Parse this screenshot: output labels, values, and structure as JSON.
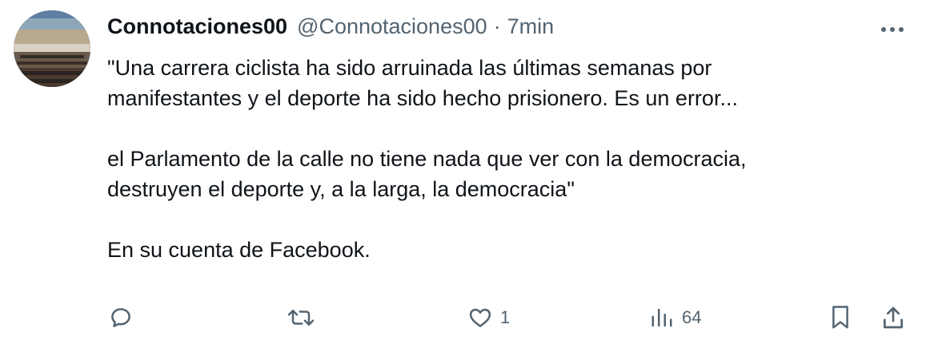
{
  "tweet": {
    "display_name": "Connotaciones00",
    "handle": "@Connotaciones00",
    "separator": "·",
    "time": "7min",
    "lines": [
      "\"Una carrera ciclista ha sido arruinada las últimas semanas por",
      "manifestantes y el deporte ha sido hecho prisionero. Es un error...",
      "",
      "el Parlamento de la calle no tiene nada que ver con la democracia,",
      "destruyen el deporte y, a la larga, la democracia\"",
      "",
      "En su cuenta de Facebook."
    ]
  },
  "actions": {
    "reply": {
      "icon": "reply-icon",
      "count": ""
    },
    "retweet": {
      "icon": "retweet-icon",
      "count": ""
    },
    "like": {
      "icon": "heart-icon",
      "count": "1"
    },
    "views": {
      "icon": "views-icon",
      "count": "64"
    },
    "bookmark": {
      "icon": "bookmark-icon"
    },
    "share": {
      "icon": "share-icon"
    }
  },
  "colors": {
    "text": "#0f1419",
    "secondary": "#536471",
    "background": "#ffffff"
  }
}
